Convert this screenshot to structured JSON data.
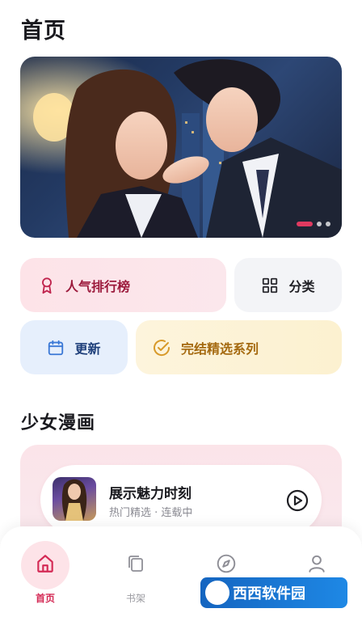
{
  "header": {
    "title": "首页"
  },
  "banner": {
    "slide_count": 3,
    "active_index": 0,
    "accent": "#e03a60"
  },
  "quick_actions": {
    "ranking": {
      "label": "人气排行榜",
      "icon": "award-icon",
      "color": "#9c1a3c"
    },
    "category": {
      "label": "分类",
      "icon": "grid-icon"
    },
    "update": {
      "label": "更新",
      "icon": "calendar-icon",
      "color": "#1e3f7a"
    },
    "finished": {
      "label": "完结精选系列",
      "icon": "check-circle-icon",
      "color": "#a56a10"
    }
  },
  "section": {
    "title": "少女漫画"
  },
  "featured": {
    "title": "展示魅力时刻",
    "subtitle": "热门精选 · 连载中",
    "action_icon": "play-circle-icon"
  },
  "nav": {
    "items": [
      {
        "label": "首页",
        "icon": "home-icon",
        "active": true
      },
      {
        "label": "书架",
        "icon": "bookshelf-icon",
        "active": false
      },
      {
        "label": "",
        "icon": "compass-icon",
        "active": false
      },
      {
        "label": "",
        "icon": "user-icon",
        "active": false
      }
    ]
  },
  "watermark": {
    "text": "西西软件园"
  }
}
